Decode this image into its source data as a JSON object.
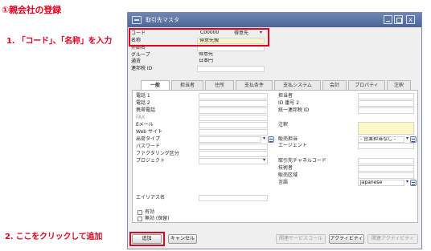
{
  "annotations": {
    "title": "①親会社の登録",
    "step1": "1. 「コード」、「名称」を入力",
    "step2": "2. ここをクリックして追加"
  },
  "window": {
    "title": "取引先マスタ",
    "close_glyph": "x"
  },
  "header": {
    "code_label": "コード",
    "code_value": "C00000",
    "code_type": "得意先",
    "name_label": "名称",
    "name_value": "得意先親",
    "foreign_name_label": "外部名",
    "group_label": "グループ",
    "group_value": "得意先",
    "currency_label": "通貨",
    "currency_value": "日本円",
    "tax_id_label": "連邦税 ID"
  },
  "tabs": [
    "一般",
    "担当者",
    "住所",
    "支払条件",
    "支払システム",
    "会計",
    "プロパティ",
    "注釈"
  ],
  "left_fields": {
    "phone1": "電話 1",
    "phone2": "電話 2",
    "mobile": "携帯電話",
    "fax": "FAX",
    "email": "Eメール",
    "web": "Web サイト",
    "shipping_type": "出荷タイプ",
    "password": "パスワード",
    "factoring": "ファクタリング区分",
    "project": "プロジェクト",
    "alias": "エイリアス名"
  },
  "right_fields": {
    "contact_person": "担当者",
    "id_no2": "ID 番号 2",
    "unified_tax_id": "統一連邦税 ID",
    "remarks": "注釈",
    "sales_employee": "販売担当",
    "sales_employee_value": "- 営業担当なし -",
    "agent": "エージェント",
    "channel_code": "取引先チャネルコード",
    "technician": "技術者",
    "territory": "販売区域",
    "language": "言語",
    "language_value": "Japanese"
  },
  "status": {
    "active": "有効",
    "inactive": "無効 (保留)"
  },
  "buttons": {
    "add": "追加",
    "cancel": "キャンセル",
    "related_service": "関連サービスコール",
    "activity": "アクティビティ",
    "related_activity": "関連アクティビティ"
  },
  "colors": {
    "annotation_red": "#e4001e",
    "titlebar_blue": "#4c6596",
    "required_yellow": "#fff8c6"
  }
}
